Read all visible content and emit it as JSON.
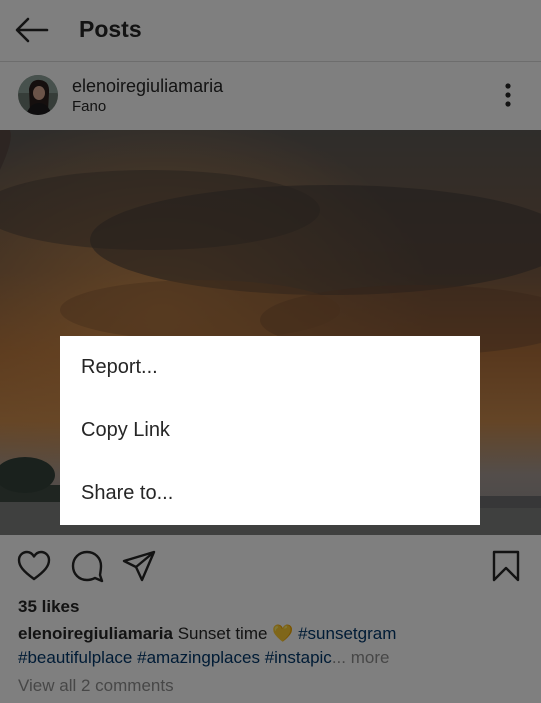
{
  "appbar": {
    "title": "Posts",
    "back_icon": "arrow-left-icon"
  },
  "post": {
    "username": "elenoiregiuliamaria",
    "location": "Fano",
    "avatar_icon": "avatar",
    "more_icon": "more-vertical-icon",
    "photo": "sunset-sky-photo"
  },
  "actions": {
    "like_icon": "heart-icon",
    "comment_icon": "comment-icon",
    "share_icon": "send-icon",
    "save_icon": "bookmark-icon"
  },
  "likes": "35 likes",
  "caption": {
    "username": "elenoiregiuliamaria",
    "text": "Sunset time",
    "emoji": "💛",
    "tags": [
      "#sunsetgram",
      "#beautifulplace",
      "#amazingplaces",
      "#instapic"
    ],
    "ellipsis": "...",
    "more": "more"
  },
  "comments_link": "View all 2 comments",
  "dialog": {
    "items": [
      {
        "label": "Report..."
      },
      {
        "label": "Copy Link"
      },
      {
        "label": "Share to..."
      }
    ]
  },
  "colors": {
    "text": "#262626",
    "hashtag": "#00376b",
    "secondary": "#8e8e8e",
    "overlay": "rgba(0,0,0,0.5)",
    "dialog_bg": "#ffffff"
  }
}
